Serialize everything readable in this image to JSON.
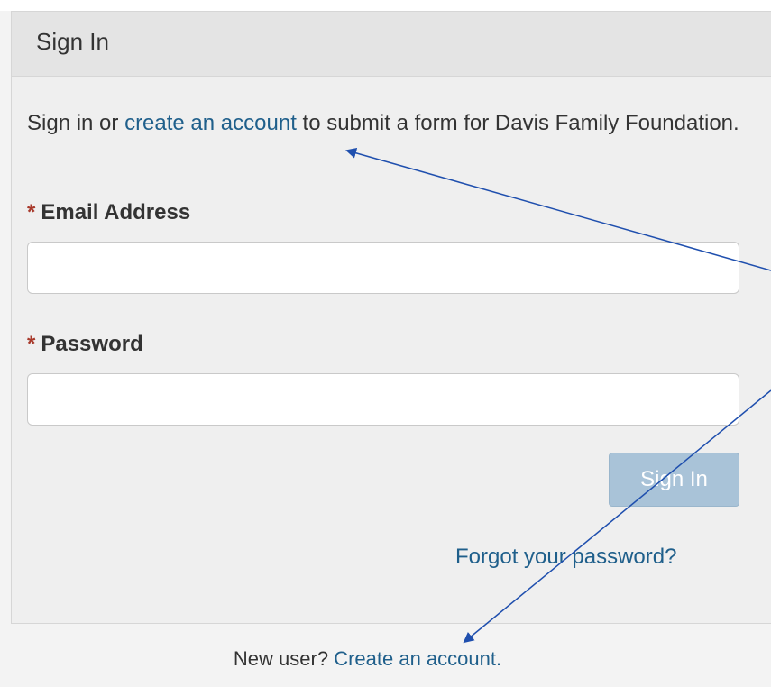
{
  "panel": {
    "title": "Sign In"
  },
  "intro": {
    "prefix": "Sign in or ",
    "link": "create an account",
    "suffix": " to submit a form for Davis Family Foundation."
  },
  "form": {
    "email_label": "Email Address",
    "password_label": "Password",
    "required_marker": "*",
    "email_value": "",
    "password_value": "",
    "submit_label": "Sign In",
    "forgot_label": "Forgot your password?"
  },
  "footer": {
    "prefix": "New user? ",
    "link": "Create an account."
  },
  "colors": {
    "link": "#1f5f8b",
    "required": "#a83a2c",
    "button": "#a9c3d8",
    "annotation_arrow": "#1f4fae"
  }
}
